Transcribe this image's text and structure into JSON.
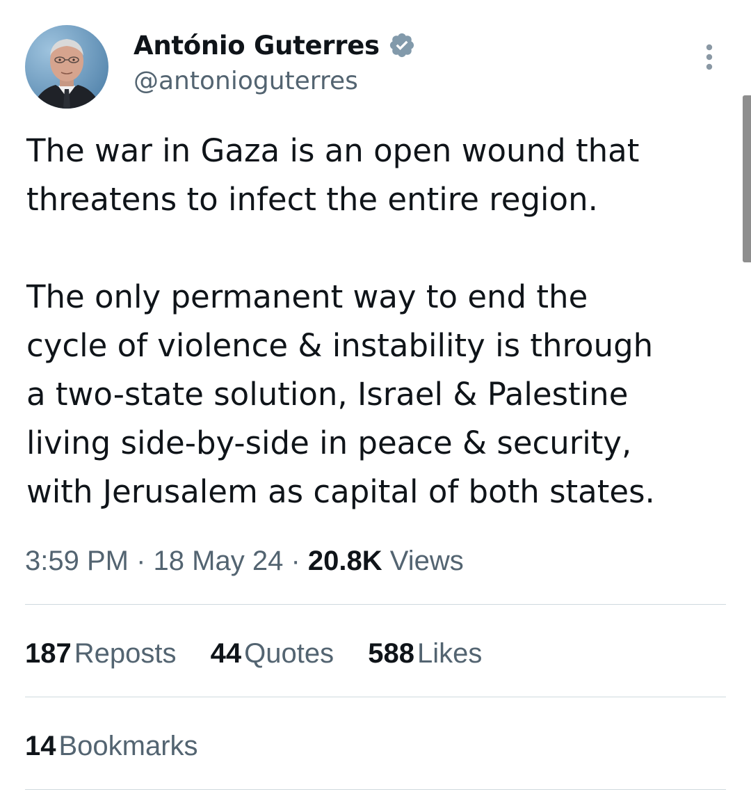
{
  "author": {
    "display_name": "António Guterres",
    "handle": "@antonioguterres",
    "verified": true,
    "avatar_icon": "profile-photo",
    "verified_icon": "verified-badge-icon",
    "verified_color": "#829aab"
  },
  "menu": {
    "icon": "more-vertical-icon"
  },
  "tweet": {
    "paragraphs": [
      [
        "The war in Gaza is an open wound that",
        "threatens to infect the entire region."
      ],
      [
        "The only permanent way to end the",
        "cycle of violence & instability is through",
        "a two-state solution, Israel & Palestine",
        "living side-by-side in peace & security,",
        "with Jerusalem as capital of both states."
      ]
    ]
  },
  "meta": {
    "time": "3:59 PM",
    "date": "18 May 24",
    "separator": "·",
    "views_count": "20.8K",
    "views_label": "Views"
  },
  "stats": {
    "reposts_count": "187",
    "reposts_label": "Reposts",
    "quotes_count": "44",
    "quotes_label": "Quotes",
    "likes_count": "588",
    "likes_label": "Likes",
    "bookmarks_count": "14",
    "bookmarks_label": "Bookmarks"
  },
  "colors": {
    "text_primary": "#0f1419",
    "text_secondary": "#536471",
    "divider": "#cfd9de"
  }
}
